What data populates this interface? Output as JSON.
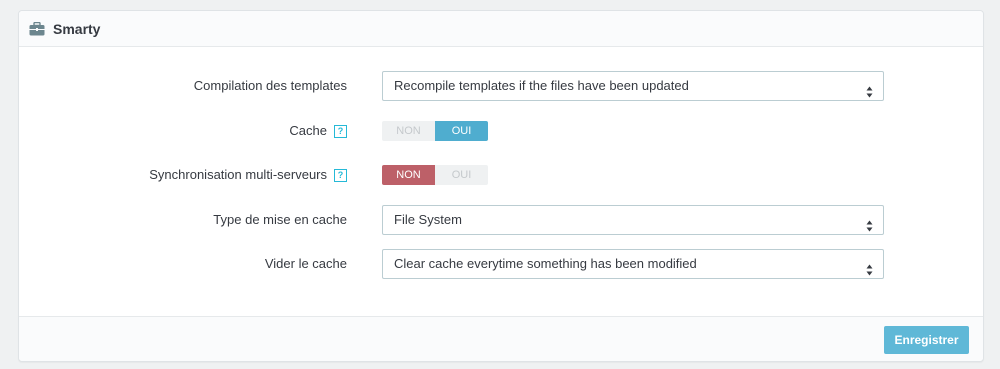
{
  "panel": {
    "title": "Smarty",
    "icon": "briefcase-icon"
  },
  "fields": {
    "compilation": {
      "label": "Compilation des templates",
      "value": "Recompile templates if the files have been updated"
    },
    "cache": {
      "label": "Cache",
      "help": "?",
      "off_label": "NON",
      "on_label": "OUI",
      "selected": "OUI",
      "active_color": "#4fadcf"
    },
    "sync": {
      "label": "Synchronisation multi-serveurs",
      "help": "?",
      "off_label": "NON",
      "on_label": "OUI",
      "selected": "NON",
      "active_color": "#bd6068"
    },
    "cache_type": {
      "label": "Type de mise en cache",
      "value": "File System"
    },
    "clear_cache": {
      "label": "Vider le cache",
      "value": "Clear cache everytime something has been modified"
    }
  },
  "footer": {
    "save_label": "Enregistrer"
  },
  "colors": {
    "accent": "#5fb8d7",
    "help": "#25b9d7"
  }
}
